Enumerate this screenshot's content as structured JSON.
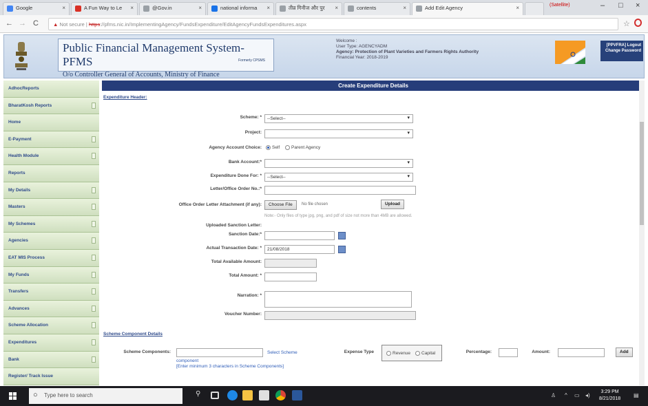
{
  "browser": {
    "tabs": [
      {
        "label": "Google",
        "fav": "#4285f4"
      },
      {
        "label": "A Fun Way to Le",
        "fav": "#d93025"
      },
      {
        "label": "@Gov.in",
        "fav": "#9aa0a6"
      },
      {
        "label": "national informa",
        "fav": "#1a73e8"
      },
      {
        "label": "तीव्र गिनीज और पुर",
        "fav": "#9aa0a6"
      },
      {
        "label": "contents",
        "fav": "#9aa0a6"
      },
      {
        "label": "Add Edit Agency",
        "fav": "#9aa0a6"
      }
    ],
    "tab_extra": "(Satellite)",
    "url_warning": "Not secure",
    "url_scheme": "https",
    "url_rest": "://pfms.nic.in/ImplementingAgency/FundsExpenditure/EditAgencyFundsExpenditures.aspx"
  },
  "header": {
    "title": "Public Financial Management System-PFMS",
    "subtitle": "O/o Controller General of Accounts, Ministry of Finance",
    "tag": "Formerly CPSMS",
    "welcome_lines": [
      "Welcome :",
      "User Type: AGENCYADM",
      "Agency: Protection of Plant Varieties and Farmers Rights Authority",
      "Financial Year: 2018-2019"
    ],
    "link1": "[PPVFRA] Logout",
    "link2": "Change Password"
  },
  "sidebar": {
    "items": [
      {
        "label": "AdhocReports",
        "arrow": false
      },
      {
        "label": "BharatKosh Reports",
        "arrow": true
      },
      {
        "label": "Home",
        "arrow": false
      },
      {
        "label": "E-Payment",
        "arrow": true
      },
      {
        "label": "Health Module",
        "arrow": true
      },
      {
        "label": "Reports",
        "arrow": false
      },
      {
        "label": "My Details",
        "arrow": true
      },
      {
        "label": "Masters",
        "arrow": true
      },
      {
        "label": "My Schemes",
        "arrow": true
      },
      {
        "label": "Agencies",
        "arrow": true
      },
      {
        "label": "EAT MIS Process",
        "arrow": true
      },
      {
        "label": "My Funds",
        "arrow": true
      },
      {
        "label": "Transfers",
        "arrow": true
      },
      {
        "label": "Advances",
        "arrow": true
      },
      {
        "label": "Scheme Allocation",
        "arrow": true
      },
      {
        "label": "Expenditures",
        "arrow": true
      },
      {
        "label": "Bank",
        "arrow": true
      },
      {
        "label": "Register/ Track Issue",
        "arrow": false
      }
    ]
  },
  "form": {
    "title": "Create Expenditure Details",
    "section1": "Expenditure Header:",
    "scheme_label": "Scheme: *",
    "scheme_value": "--Select--",
    "project_label": "Project:",
    "agency_account_label": "Agency Account Choice:",
    "radio_self": "Self",
    "radio_parent": "Parent Agency",
    "bank_account_label": "Bank Account:*",
    "exp_done_label": "Expenditure Done For: *",
    "exp_done_value": "--Select--",
    "letter_label": "Letter/Office Order No.:*",
    "attach_label": "Office Order Letter Attachment (if any):",
    "choose_file": "Choose File",
    "no_file": "No file chosen",
    "upload": "Upload",
    "note": "Note:- Only files of type jpg, png, and pdf of size not more than 4MB are allowed.",
    "uploaded_label": "Uploaded Sanction Letter:",
    "sanction_date_label": "Sanction Date:*",
    "actual_date_label": "Actual Transaction Date: *",
    "actual_date_value": "21/08/2018",
    "total_avail_label": "Total Available Amount:",
    "total_amount_label": "Total Amount: *",
    "narration_label": "Narration: *",
    "voucher_label": "Voucher Number:",
    "section2": "Scheme Component Details",
    "scheme_comp_label": "Scheme Components:",
    "select_scheme": "Select Scheme",
    "component_link": "component",
    "comp_hint": "[Enter minimum 3 characters in Scheme Components]",
    "expense_type_label": "Expense Type",
    "radio_revenue": "Revenue",
    "radio_capital": "Capital",
    "percentage_label": "Percentage:",
    "amount_label": "Amount:",
    "add": "Add"
  },
  "taskbar": {
    "search_placeholder": "Type here to search",
    "time": "3:29 PM",
    "date": "8/21/2018"
  }
}
